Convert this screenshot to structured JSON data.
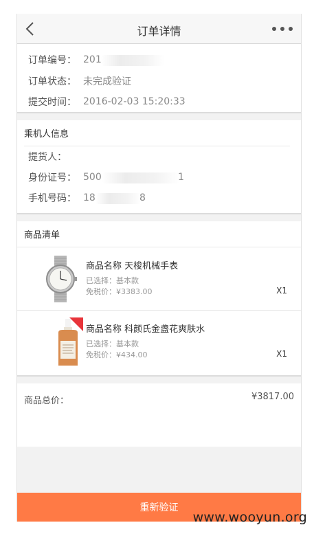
{
  "nav": {
    "title": "订单详情"
  },
  "order": {
    "number_label": "订单编号：",
    "number_value": "201",
    "status_label": "订单状态：",
    "status_value": "未完成验证",
    "time_label": "提交时间：",
    "time_value": "2016-02-03 15:20:33"
  },
  "passenger": {
    "title": "乘机人信息",
    "pickup_label": "提货人：",
    "pickup_value": "",
    "id_label": "身份证号：",
    "id_prefix": "500",
    "id_suffix": "1",
    "phone_label": "手机号码：",
    "phone_prefix": "18",
    "phone_suffix": "8"
  },
  "goods": {
    "title": "商品清单",
    "items": [
      {
        "name": "商品名称  天梭机械手表",
        "spec": "已选择：基本款",
        "price": "免税价：¥3383.00",
        "qty": "X1",
        "thumb": "watch-image"
      },
      {
        "name": "商品名称  科颜氏金盏花爽肤水",
        "spec": "已选择：基本款",
        "price": "免税价：¥434.00",
        "qty": "X1",
        "thumb": "toner-bottle-image"
      }
    ]
  },
  "total": {
    "label": "商品总价：",
    "value": "¥3817.00"
  },
  "actions": {
    "reverify_label": "重新验证"
  },
  "watermark": "www.wooyun.org",
  "colors": {
    "accent": "#ff7a45",
    "badge": "#e8343a"
  }
}
